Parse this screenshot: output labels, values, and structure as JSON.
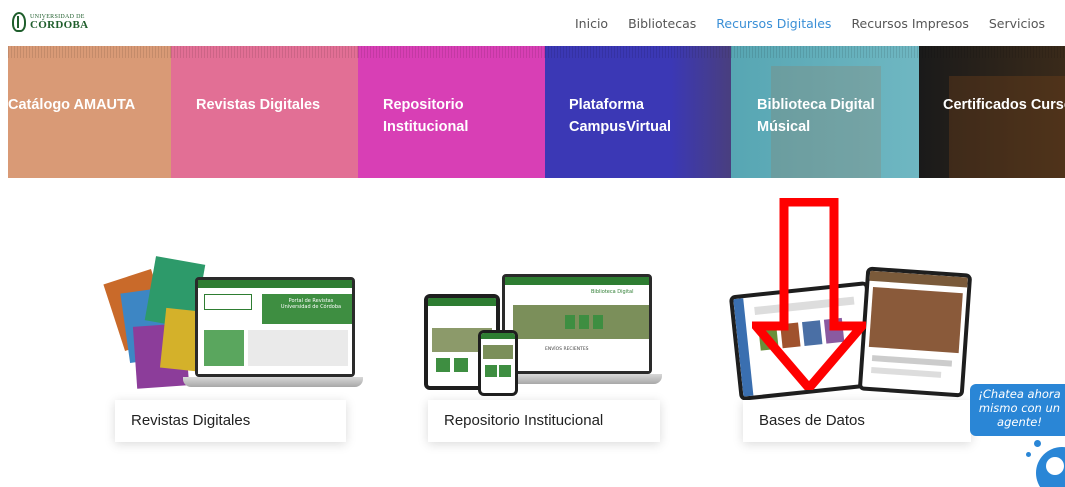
{
  "header": {
    "logo": {
      "small": "UNIVERSIDAD DE",
      "big": "CÓRDOBA"
    },
    "nav": [
      {
        "label": "Inicio",
        "active": false
      },
      {
        "label": "Bibliotecas",
        "active": false
      },
      {
        "label": "Recursos Digitales",
        "active": true
      },
      {
        "label": "Recursos Impresos",
        "active": false
      },
      {
        "label": "Servicios",
        "active": false
      }
    ]
  },
  "tiles": [
    {
      "line1": "Catálogo AMAUTA",
      "line2": ""
    },
    {
      "line1": "Revistas Digitales",
      "line2": ""
    },
    {
      "line1": "Repositorio",
      "line2": "Institucional"
    },
    {
      "line1": "Plataforma",
      "line2": "CampusVirtual"
    },
    {
      "line1": "Biblioteca Digital",
      "line2": "Músical"
    },
    {
      "line1": "Certificados Curso",
      "line2": ""
    }
  ],
  "cards": [
    {
      "label": "Revistas Digitales",
      "image": "revistas-devices-illustration"
    },
    {
      "label": "Repositorio Institucional",
      "image": "repositorio-devices-illustration"
    },
    {
      "label": "Bases de Datos",
      "image": "bases-de-datos-devices-illustration"
    }
  ],
  "screen_text": {
    "portal_revistas_l1": "Portal de Revistas",
    "portal_revistas_l2": "Universidad de Córdoba",
    "biblioteca_digital": "Biblioteca Digital",
    "envios_recientes": "ENVÍOS RECIENTES"
  },
  "annotation": {
    "arrow_color": "#ff0000",
    "arrow_direction": "down"
  },
  "chat": {
    "line1": "¡Chatea ahora",
    "line2": "mismo con un",
    "line3": "agente!",
    "color": "#2a86d6"
  },
  "colors": {
    "nav_active": "#3a8fd6",
    "brand_green": "#1f5e2c"
  }
}
